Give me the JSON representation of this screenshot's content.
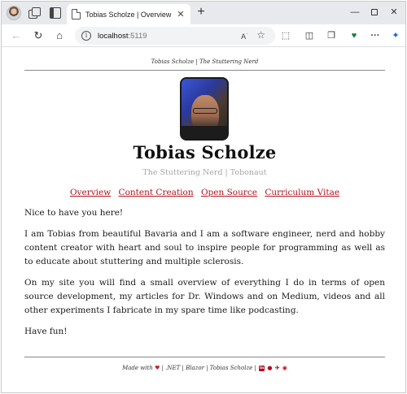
{
  "browser": {
    "tab_title": "Tobias Scholze | Overview",
    "tab_close": "✕",
    "new_tab": "+",
    "url_host": "localhost",
    "url_port": ":5119",
    "read_aloud": "Aʬ",
    "win_min": "—",
    "win_close": "✕"
  },
  "page": {
    "header_line": "Tobias Scholze | The Stuttering Nerd",
    "name": "Tobias Scholze",
    "subtitle": "The Stuttering Nerd | Tobonaut",
    "menu": [
      "Overview",
      "Content Creation",
      "Open Source",
      "Curriculum Vitae"
    ],
    "paragraphs": [
      "Nice to have you here!",
      "I am Tobias from beautiful Bavaria and I am a software engineer, nerd and hobby content creator with heart and soul to inspire people for programming as well as to educate about stuttering and multiple sclerosis.",
      "On my site you will find a small overview of everything I do in terms of open source development, my articles for Dr. Windows and on Medium, videos and all other experiments I fabricate in my spare time like podcasting.",
      "Have fun!"
    ],
    "footer": {
      "made_with": "Made with",
      "heart": "♥",
      "rest": "| .NET | Blazor | Tobias Scholze |",
      "icons": [
        "linkedin-icon",
        "github-icon",
        "twitter-icon",
        "mastodon-icon"
      ]
    }
  },
  "colors": {
    "link": "#b3121d",
    "subtitle": "#a6a6a6",
    "heart": "#c41a27"
  }
}
